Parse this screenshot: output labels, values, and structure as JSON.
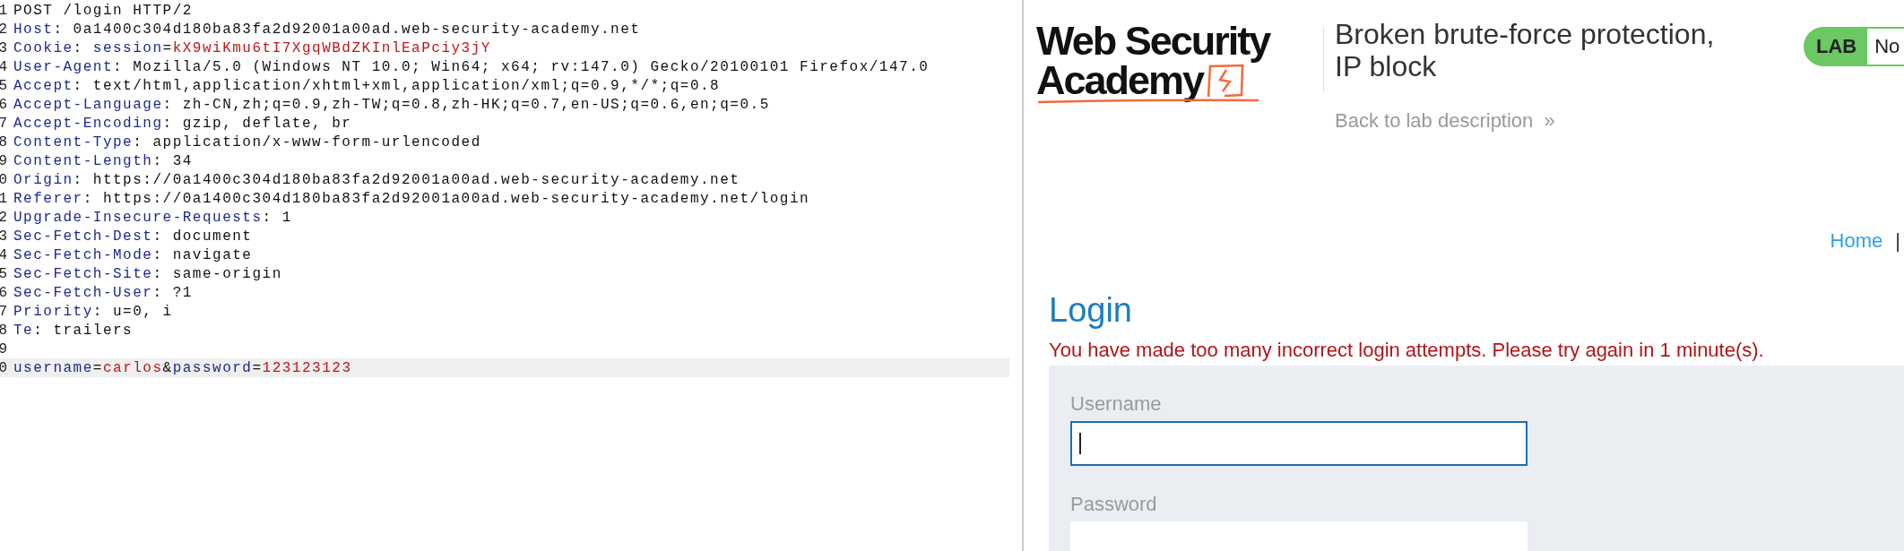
{
  "request_editor": {
    "lines": [
      {
        "number": "1",
        "highlighted": false,
        "parts": [
          {
            "text": "POST /login HTTP/2",
            "kind": "plain"
          }
        ]
      },
      {
        "number": "2",
        "highlighted": false,
        "parts": [
          {
            "text": "Host",
            "kind": "key"
          },
          {
            "text": ": 0a1400c304d180ba83fa2d92001a00ad.web-security-academy.net",
            "kind": "plain"
          }
        ]
      },
      {
        "number": "3",
        "highlighted": false,
        "parts": [
          {
            "text": "Cookie",
            "kind": "key"
          },
          {
            "text": ": ",
            "kind": "plain"
          },
          {
            "text": "session",
            "kind": "key"
          },
          {
            "text": "=",
            "kind": "plain"
          },
          {
            "text": "kX9wiKmu6tI7XgqWBdZKInlEaPciy3jY",
            "kind": "value"
          }
        ]
      },
      {
        "number": "4",
        "highlighted": false,
        "parts": [
          {
            "text": "User-Agent",
            "kind": "key"
          },
          {
            "text": ": Mozilla/5.0 (Windows NT 10.0; Win64; x64; rv:147.0) Gecko/20100101 Firefox/147.0",
            "kind": "plain"
          }
        ]
      },
      {
        "number": "5",
        "highlighted": false,
        "parts": [
          {
            "text": "Accept",
            "kind": "key"
          },
          {
            "text": ": text/html,application/xhtml+xml,application/xml;q=0.9,*/*;q=0.8",
            "kind": "plain"
          }
        ]
      },
      {
        "number": "6",
        "highlighted": false,
        "parts": [
          {
            "text": "Accept-Language",
            "kind": "key"
          },
          {
            "text": ": zh-CN,zh;q=0.9,zh-TW;q=0.8,zh-HK;q=0.7,en-US;q=0.6,en;q=0.5",
            "kind": "plain"
          }
        ]
      },
      {
        "number": "7",
        "highlighted": false,
        "parts": [
          {
            "text": "Accept-Encoding",
            "kind": "key"
          },
          {
            "text": ": gzip, deflate, br",
            "kind": "plain"
          }
        ]
      },
      {
        "number": "8",
        "highlighted": false,
        "parts": [
          {
            "text": "Content-Type",
            "kind": "key"
          },
          {
            "text": ": application/x-www-form-urlencoded",
            "kind": "plain"
          }
        ]
      },
      {
        "number": "9",
        "highlighted": false,
        "parts": [
          {
            "text": "Content-Length",
            "kind": "key"
          },
          {
            "text": ": 34",
            "kind": "plain"
          }
        ]
      },
      {
        "number": "0",
        "highlighted": false,
        "parts": [
          {
            "text": "Origin",
            "kind": "key"
          },
          {
            "text": ": https://0a1400c304d180ba83fa2d92001a00ad.web-security-academy.net",
            "kind": "plain"
          }
        ]
      },
      {
        "number": "1",
        "highlighted": false,
        "parts": [
          {
            "text": "Referer",
            "kind": "key"
          },
          {
            "text": ": https://0a1400c304d180ba83fa2d92001a00ad.web-security-academy.net/login",
            "kind": "plain"
          }
        ]
      },
      {
        "number": "2",
        "highlighted": false,
        "parts": [
          {
            "text": "Upgrade-Insecure-Requests",
            "kind": "key"
          },
          {
            "text": ": 1",
            "kind": "plain"
          }
        ]
      },
      {
        "number": "3",
        "highlighted": false,
        "parts": [
          {
            "text": "Sec-Fetch-Dest",
            "kind": "key"
          },
          {
            "text": ": document",
            "kind": "plain"
          }
        ]
      },
      {
        "number": "4",
        "highlighted": false,
        "parts": [
          {
            "text": "Sec-Fetch-Mode",
            "kind": "key"
          },
          {
            "text": ": navigate",
            "kind": "plain"
          }
        ]
      },
      {
        "number": "5",
        "highlighted": false,
        "parts": [
          {
            "text": "Sec-Fetch-Site",
            "kind": "key"
          },
          {
            "text": ": same-origin",
            "kind": "plain"
          }
        ]
      },
      {
        "number": "6",
        "highlighted": false,
        "parts": [
          {
            "text": "Sec-Fetch-User",
            "kind": "key"
          },
          {
            "text": ": ?1",
            "kind": "plain"
          }
        ]
      },
      {
        "number": "7",
        "highlighted": false,
        "parts": [
          {
            "text": "Priority",
            "kind": "key"
          },
          {
            "text": ": u=0, i",
            "kind": "plain"
          }
        ]
      },
      {
        "number": "8",
        "highlighted": false,
        "parts": [
          {
            "text": "Te",
            "kind": "key"
          },
          {
            "text": ": trailers",
            "kind": "plain"
          }
        ]
      },
      {
        "number": "9",
        "highlighted": false
      },
      {
        "number": "0",
        "highlighted": true,
        "parts": [
          {
            "text": "username",
            "kind": "key"
          },
          {
            "text": "=",
            "kind": "plain"
          },
          {
            "text": "carlos",
            "kind": "value"
          },
          {
            "text": "&",
            "kind": "plain"
          },
          {
            "text": "password",
            "kind": "key"
          },
          {
            "text": "=",
            "kind": "plain"
          },
          {
            "text": "123123123",
            "kind": "value"
          }
        ]
      }
    ]
  },
  "lab_page": {
    "logo": {
      "line_1": "Web Security",
      "line_2": "Academy"
    },
    "lab_title": "Broken brute-force protection, IP block",
    "back_link": "Back to lab description",
    "back_link_icon": "»",
    "lab_badge": "LAB",
    "lab_status": "No",
    "nav": {
      "home_link": "Home",
      "separator": "|"
    },
    "heading": "Login",
    "error_message": "You have made too many incorrect login attempts. Please try again in 1 minute(s).",
    "form": {
      "fields": [
        {
          "label": "Username",
          "focused": true
        },
        {
          "label": "Password",
          "focused": false
        }
      ]
    }
  }
}
